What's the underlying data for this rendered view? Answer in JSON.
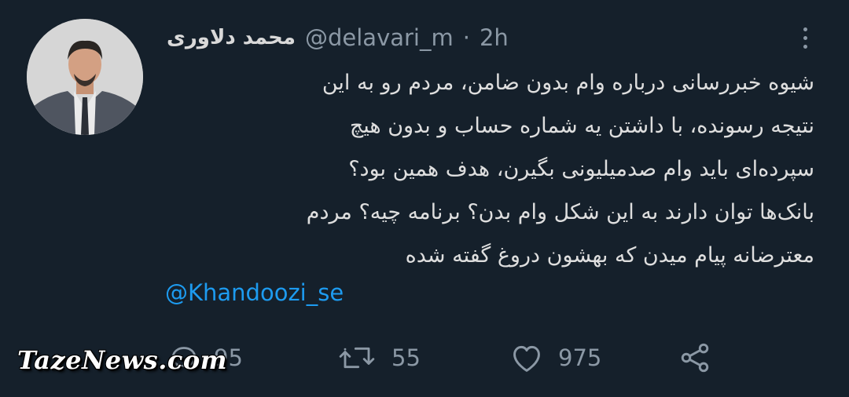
{
  "tweet": {
    "author_name": "محمد دلاوری",
    "handle": "@delavari_m",
    "separator": "·",
    "time": "2h",
    "lines": [
      "شیوه خبررسانی درباره وام بدون ضامن، مردم رو به این",
      "نتیجه رسونده، با داشتن یه شماره حساب و بدون هیچ",
      "سپرده‌ای باید وام صدمیلیونی بگیرن، هدف همین بود؟",
      "بانک‌ها توان دارند به این شکل وام بدن؟ برنامه چیه؟ مردم",
      "معترضانه پیام میدن که بهشون دروغ گفته شده"
    ],
    "mention": "@Khandoozi_se"
  },
  "actions": {
    "reply_count": "95",
    "retweet_count": "55",
    "like_count": "975"
  },
  "icons": {
    "more": "more-vertical-icon",
    "reply": "reply-icon",
    "retweet": "retweet-icon",
    "like": "heart-icon",
    "share": "share-icon"
  },
  "watermark": "TazeNews.com",
  "colors": {
    "background": "#15202b",
    "text": "#d9d9d9",
    "secondary": "#8b98a5",
    "link": "#1d9bf0"
  }
}
